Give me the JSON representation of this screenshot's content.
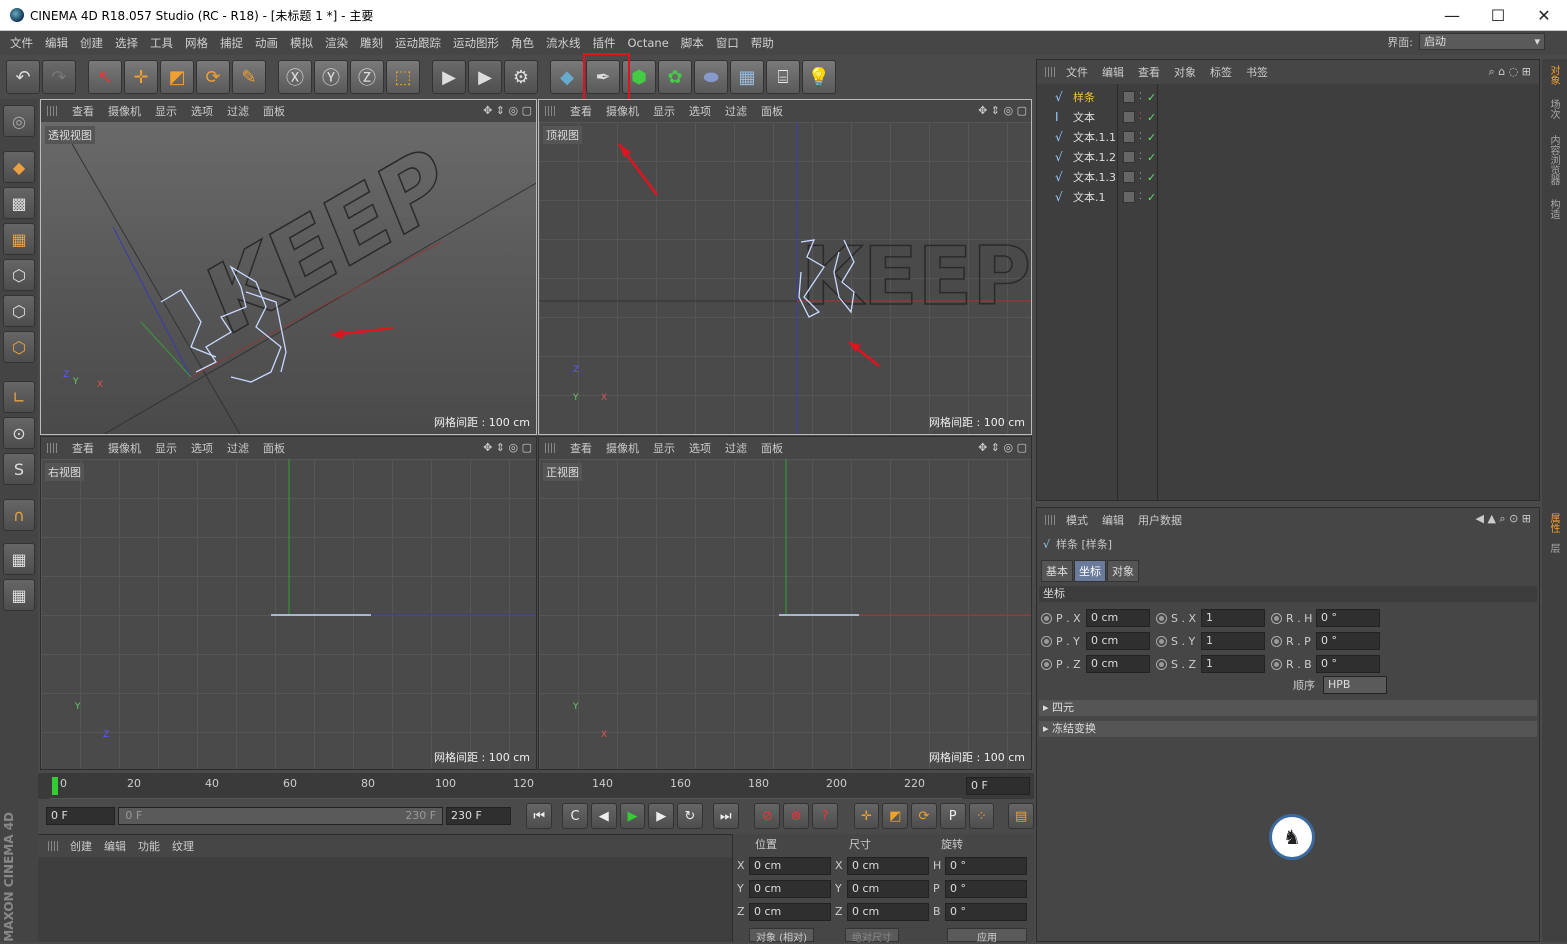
{
  "window": {
    "title": "CINEMA 4D R18.057 Studio (RC - R18) - [未标题 1 *] - 主要",
    "minimize": "—",
    "maximize": "☐",
    "close": "✕"
  },
  "menu": [
    "文件",
    "编辑",
    "创建",
    "选择",
    "工具",
    "网格",
    "捕捉",
    "动画",
    "模拟",
    "渲染",
    "雕刻",
    "运动跟踪",
    "运动图形",
    "角色",
    "流水线",
    "插件",
    "Octane",
    "脚本",
    "窗口",
    "帮助"
  ],
  "layout": {
    "label": "界面:",
    "value": "启动"
  },
  "viewports": [
    {
      "menu": [
        "查看",
        "摄像机",
        "显示",
        "选项",
        "过滤",
        "面板"
      ],
      "label": "透视视图",
      "grid": "网格间距 : 100 cm"
    },
    {
      "menu": [
        "查看",
        "摄像机",
        "显示",
        "选项",
        "过滤",
        "面板"
      ],
      "label": "顶视图",
      "grid": "网格间距 : 100 cm"
    },
    {
      "menu": [
        "查看",
        "摄像机",
        "显示",
        "选项",
        "过滤",
        "面板"
      ],
      "label": "右视图",
      "grid": "网格间距 : 100 cm"
    },
    {
      "menu": [
        "查看",
        "摄像机",
        "显示",
        "选项",
        "过滤",
        "面板"
      ],
      "label": "正视图",
      "grid": "网格间距 : 100 cm"
    }
  ],
  "viewport_text": "KEEP",
  "axes": {
    "x": "X",
    "y": "Y",
    "z": "Z"
  },
  "timeline": {
    "ticks": [
      "0",
      "20",
      "40",
      "60",
      "80",
      "100",
      "120",
      "140",
      "160",
      "180",
      "200",
      "220"
    ],
    "current": "0 F"
  },
  "playback": {
    "start": "0 F",
    "range_start": "0 F",
    "range_end": "230 F",
    "end": "230 F"
  },
  "material": {
    "menu": [
      "创建",
      "编辑",
      "功能",
      "纹理"
    ]
  },
  "coords": {
    "headers": [
      "位置",
      "尺寸",
      "旋转"
    ],
    "rows": [
      {
        "a": "X",
        "pos": "0 cm",
        "b": "X",
        "size": "0 cm",
        "c": "H",
        "rot": "0 °"
      },
      {
        "a": "Y",
        "pos": "0 cm",
        "b": "Y",
        "size": "0 cm",
        "c": "P",
        "rot": "0 °"
      },
      {
        "a": "Z",
        "pos": "0 cm",
        "b": "Z",
        "size": "0 cm",
        "c": "B",
        "rot": "0 °"
      }
    ],
    "mode": "对象 (相对)",
    "size_mode": "绝对尺寸",
    "apply": "应用"
  },
  "objects": {
    "menu": [
      "文件",
      "编辑",
      "查看",
      "对象",
      "标签",
      "书签"
    ],
    "items": [
      {
        "name": "样条",
        "selected": true
      },
      {
        "name": "文本",
        "selected": false
      },
      {
        "name": "文本.1.1",
        "selected": false
      },
      {
        "name": "文本.1.2",
        "selected": false
      },
      {
        "name": "文本.1.3",
        "selected": false
      },
      {
        "name": "文本.1",
        "selected": false
      }
    ]
  },
  "attributes": {
    "menu": [
      "模式",
      "编辑",
      "用户数据"
    ],
    "object": "样条 [样条]",
    "tabs": [
      "基本",
      "坐标",
      "对象"
    ],
    "active_tab": "坐标",
    "section": "坐标",
    "rows": [
      [
        {
          "l": "P . X",
          "v": "0 cm"
        },
        {
          "l": "S . X",
          "v": "1"
        },
        {
          "l": "R . H",
          "v": "0 °"
        }
      ],
      [
        {
          "l": "P . Y",
          "v": "0 cm"
        },
        {
          "l": "S . Y",
          "v": "1"
        },
        {
          "l": "R . P",
          "v": "0 °"
        }
      ],
      [
        {
          "l": "P . Z",
          "v": "0 cm"
        },
        {
          "l": "S . Z",
          "v": "1"
        },
        {
          "l": "R . B",
          "v": "0 °"
        }
      ]
    ],
    "order_label": "顺序",
    "order_value": "HPB",
    "sections": [
      "四元",
      "冻结变换"
    ]
  },
  "right_tabs": [
    "对象",
    "场次",
    "内容浏览器",
    "构造"
  ],
  "right_tabs2": [
    "属性",
    "层"
  ],
  "brand": "MAXON CINEMA 4D",
  "colors": {
    "accent": "#e0141e",
    "selected": "#f0c040",
    "x_axis": "#c03030",
    "y_axis": "#30a030",
    "z_axis": "#3040c0"
  }
}
